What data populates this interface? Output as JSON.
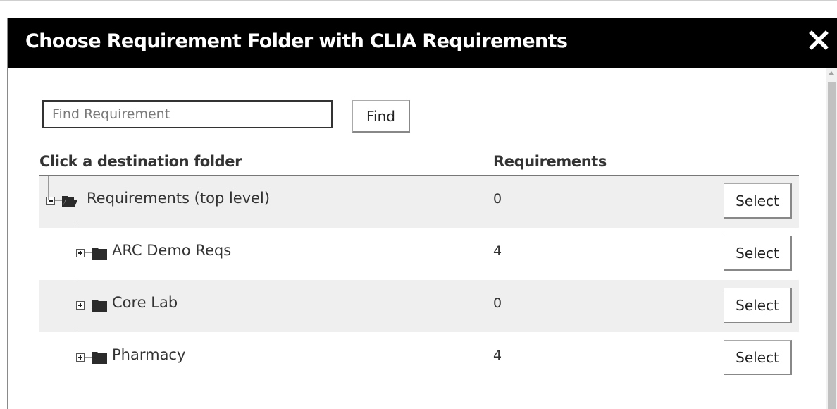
{
  "dialog": {
    "title": "Choose Requirement Folder with CLIA Requirements",
    "close_icon": "close-icon"
  },
  "search": {
    "placeholder": "Find Requirement",
    "value": "",
    "find_label": "Find"
  },
  "table": {
    "columns": [
      "Click a destination folder",
      "Requirements"
    ],
    "rows": [
      {
        "label": "Requirements (top level)",
        "count": "0",
        "select_label": "Select",
        "level": 0,
        "expanded": true,
        "icon": "folder-open-icon"
      },
      {
        "label": "ARC Demo Reqs",
        "count": "4",
        "select_label": "Select",
        "level": 1,
        "expanded": false,
        "icon": "folder-icon"
      },
      {
        "label": "Core Lab",
        "count": "0",
        "select_label": "Select",
        "level": 1,
        "expanded": false,
        "icon": "folder-icon"
      },
      {
        "label": "Pharmacy",
        "count": "4",
        "select_label": "Select",
        "level": 1,
        "expanded": false,
        "icon": "folder-icon"
      }
    ]
  },
  "colors": {
    "titlebar_bg": "#000000",
    "titlebar_text": "#ffffff",
    "row_shade": "#efefef",
    "text": "#333333"
  }
}
